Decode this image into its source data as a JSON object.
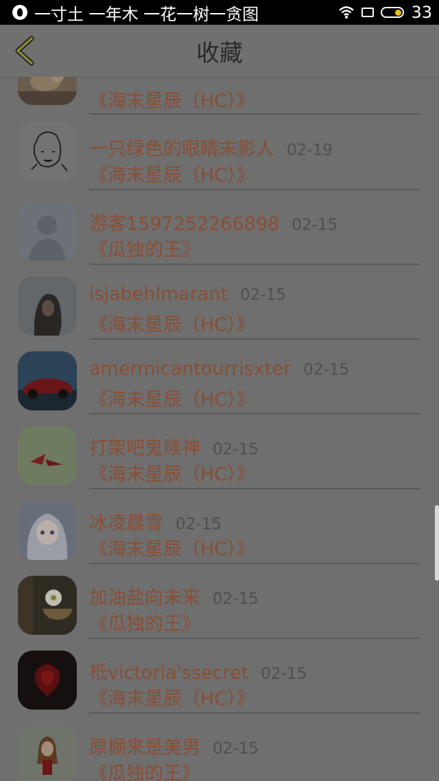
{
  "status_bar": {
    "title": "一寸土 一年木 一花一树一贪图",
    "battery": "33"
  },
  "header": {
    "title": "收藏"
  },
  "items": [
    {
      "name": "",
      "date": "",
      "book": "《海末星辰（HC）》",
      "avatar": "cat-avatar"
    },
    {
      "name": "一只绿色的眼睛末影人",
      "date": "02-19",
      "book": "《海末星辰（HC）》",
      "avatar": "sketch-avatar"
    },
    {
      "name": "游客1597252266898",
      "date": "02-15",
      "book": "《瓜独的王》",
      "avatar": "default-person-avatar"
    },
    {
      "name": "isjabehlmarant",
      "date": "02-15",
      "book": "《海末星辰（HC）》",
      "avatar": "woman-photo-avatar"
    },
    {
      "name": "amermicantourrisxter",
      "date": "02-15",
      "book": "《海末星辰（HC）》",
      "avatar": "car-avatar"
    },
    {
      "name": "打架吧鬼赎神",
      "date": "02-15",
      "book": "《海末星辰（HC）》",
      "avatar": "origami-avatar"
    },
    {
      "name": "冰凌晨雪",
      "date": "02-15",
      "book": "《海末星辰（HC）》",
      "avatar": "anime-girl-avatar"
    },
    {
      "name": "加油盐向未来",
      "date": "02-15",
      "book": "《瓜独的王》",
      "avatar": "flower-cup-avatar"
    },
    {
      "name": "柢victoria'ssecret",
      "date": "02-15",
      "book": "《海末星辰（HC）》",
      "avatar": "rose-avatar"
    },
    {
      "name": "原棚来是美男",
      "date": "02-15",
      "book": "《瓜独的王》",
      "avatar": "cartoon-girl-avatar"
    }
  ]
}
